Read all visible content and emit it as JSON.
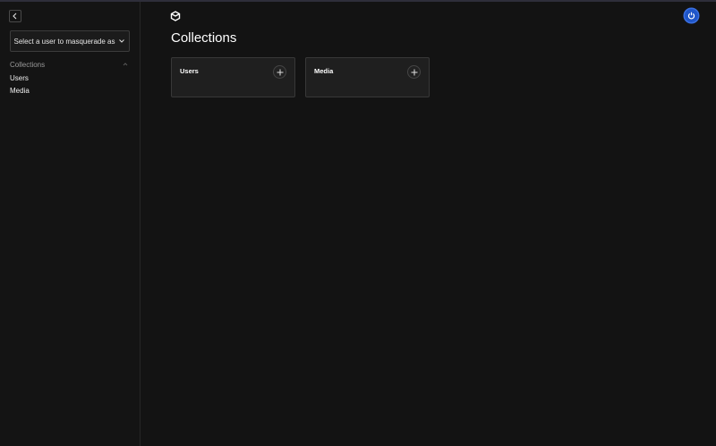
{
  "sidebar": {
    "masquerade_placeholder": "Select a user to masquerade as",
    "group_label": "Collections",
    "items": [
      {
        "label": "Users"
      },
      {
        "label": "Media"
      }
    ]
  },
  "header": {
    "logo_icon": "logo-icon",
    "logout_icon": "power-icon"
  },
  "main": {
    "title": "Collections",
    "cards": [
      {
        "label": "Users",
        "action_icon": "plus-icon"
      },
      {
        "label": "Media",
        "action_icon": "plus-icon"
      }
    ]
  },
  "colors": {
    "background": "#131313",
    "card_background": "#1f1f1f",
    "accent": "#1f56c9"
  }
}
